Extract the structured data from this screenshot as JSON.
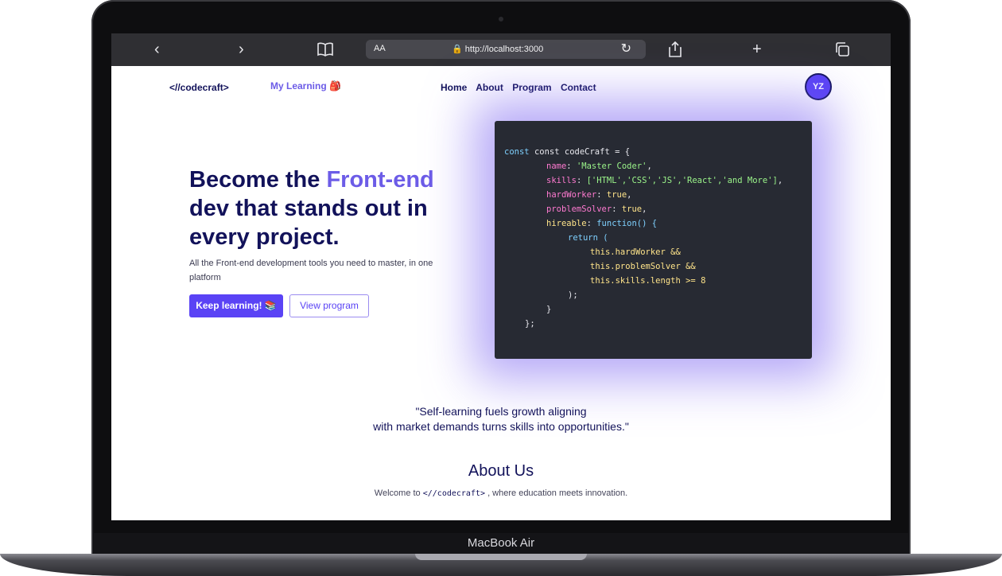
{
  "device": {
    "label": "MacBook Air"
  },
  "browser": {
    "text_size_label": "AA",
    "url": "http://localhost:3000",
    "icons": [
      "back-icon",
      "forward-icon",
      "book-icon",
      "lock-icon",
      "reload-icon",
      "share-icon",
      "plus-icon",
      "tabs-icon"
    ]
  },
  "nav": {
    "logo": "<//codecraft>",
    "my_learning": "My Learning 🎒",
    "links": [
      "Home",
      "About",
      "Program",
      "Contact"
    ],
    "avatar_initials": "YZ"
  },
  "hero": {
    "title_part1": "Become the ",
    "title_accent": "Front-end",
    "title_part2": " dev that stands out in every project.",
    "subtitle": "All the Front-end development tools you need to master, in one platform",
    "primary_button": "Keep learning! 📚",
    "secondary_button": "View program"
  },
  "code": {
    "l1": "const codeCraft = {",
    "name_key": "name",
    "name_val": "'Master Coder'",
    "skills_key": "skills",
    "skills_val": "['HTML','CSS','JS','React','and More']",
    "hard_key": "hardWorker",
    "hard_val": "true",
    "prob_key": "problemSolver",
    "prob_val": "true",
    "hire_key": "hireable",
    "hire_val": "function() {",
    "ret": "return (",
    "this1": "this.hardWorker &&",
    "this2": "this.problemSolver &&",
    "this3": "this.skills.length >= 8",
    "close1": ");",
    "close2": "}",
    "close3": "};"
  },
  "quote": {
    "line1": "\"Self-learning fuels growth aligning",
    "line2": "with market demands turns skills into opportunities.\""
  },
  "about": {
    "title": "About Us",
    "text_before": "Welcome to ",
    "brand": "<//codecraft>",
    "text_after": " , where education meets innovation."
  },
  "colors": {
    "accent": "#6c5ce7",
    "primary_button": "#5a43f5",
    "heading": "#12125a",
    "code_bg": "#272a33"
  }
}
